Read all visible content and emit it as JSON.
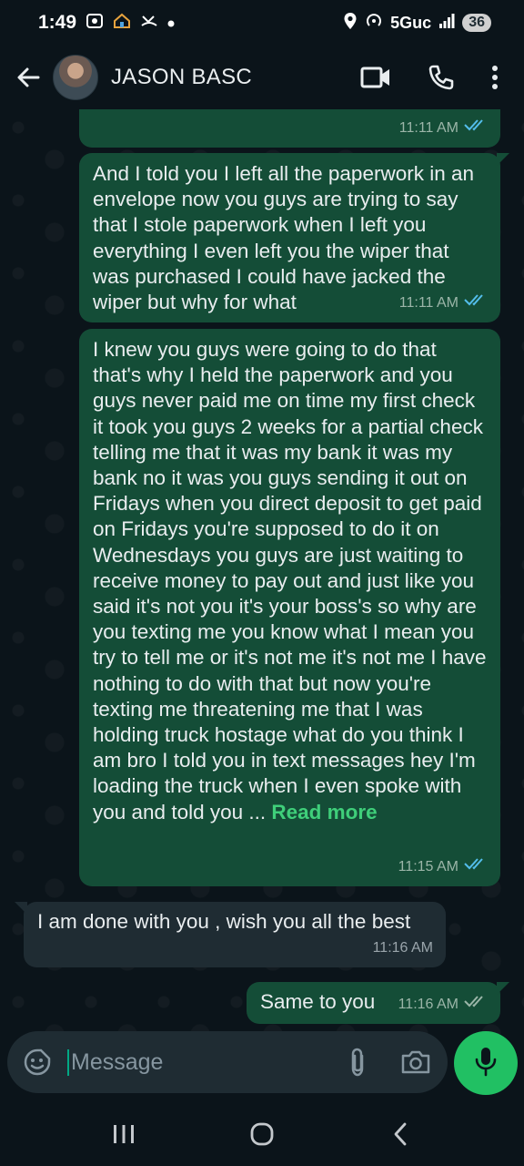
{
  "status_bar": {
    "time": "1:49",
    "left_icons": [
      "screenshot-icon",
      "home-icon",
      "missed-call-icon",
      "dot-icon"
    ],
    "network": "5Guc",
    "battery": "36"
  },
  "header": {
    "contact_name": "JASON BASC",
    "avatar": "contact-avatar",
    "actions": [
      "video-call-icon",
      "voice-call-icon",
      "more-menu-icon"
    ]
  },
  "messages": [
    {
      "direction": "outgoing",
      "text": "",
      "time": "11:11 AM",
      "status": "read"
    },
    {
      "direction": "outgoing",
      "text": "And I told you I left all the paperwork in an envelope now you guys are trying to say that I stole paperwork when I left you everything I even left you the wiper that was purchased I could have jacked the wiper but why for what",
      "time": "11:11 AM",
      "status": "read"
    },
    {
      "direction": "outgoing",
      "text": "I knew you guys were going to do that that's why I held the paperwork and you guys never paid me on time my first check it took you guys 2 weeks for a partial check telling me that it was my bank it was my bank no it was you guys sending it out on Fridays when you direct deposit to get paid on Fridays you're supposed to do it on Wednesdays you guys are just waiting to receive money to pay out and just like you said it's not you it's your boss's so why are you texting me you know what I mean you try to tell me or it's not me it's not me I have nothing to do with that but now you're texting me threatening me that I was holding truck hostage what do you think I am bro I told you in text messages hey I'm loading the truck when I even spoke with you and told you ...",
      "read_more": "Read more",
      "time": "11:15 AM",
      "status": "read"
    },
    {
      "direction": "incoming",
      "text": "I am done with you , wish you all the best",
      "time": "11:16 AM"
    },
    {
      "direction": "outgoing",
      "text": "Same to you",
      "time": "11:16 AM",
      "status": "delivered"
    }
  ],
  "composer": {
    "placeholder": "Message",
    "icons": [
      "emoji-icon",
      "attach-icon",
      "camera-icon",
      "mic-icon"
    ]
  },
  "nav_bar": {
    "icons": [
      "recents-icon",
      "home-nav-icon",
      "back-nav-icon"
    ]
  },
  "colors": {
    "background": "#0b141a",
    "outgoing_bubble": "#144d37",
    "incoming_bubble": "#1f2c33",
    "accent": "#21c063",
    "read_ticks": "#53bdeb"
  }
}
